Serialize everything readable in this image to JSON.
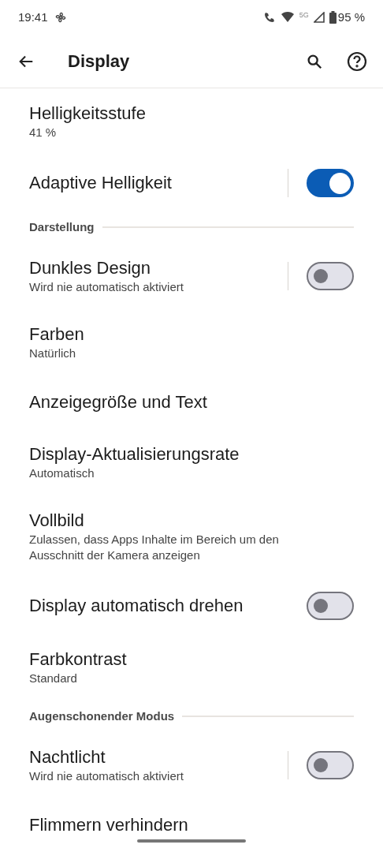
{
  "status_bar": {
    "time": "19:41",
    "battery": "95 %",
    "network": "5G"
  },
  "app_bar": {
    "title": "Display"
  },
  "items": [
    {
      "kind": "item",
      "title": "Helligkeitsstufe",
      "subtitle": "41 %"
    },
    {
      "kind": "toggle",
      "title": "Adaptive Helligkeit",
      "on": true,
      "divider": true
    },
    {
      "kind": "header",
      "title": "Darstellung"
    },
    {
      "kind": "toggle",
      "title": "Dunkles Design",
      "subtitle": "Wird nie automatisch aktiviert",
      "on": false,
      "divider": true
    },
    {
      "kind": "item",
      "title": "Farben",
      "subtitle": "Natürlich"
    },
    {
      "kind": "item",
      "title": "Anzeigegröße und Text"
    },
    {
      "kind": "item",
      "title": "Display-Aktualisierungsrate",
      "subtitle": "Automatisch"
    },
    {
      "kind": "item",
      "title": "Vollbild",
      "subtitle": "Zulassen, dass Apps Inhalte im Bereich um den Ausschnitt der Kamera anzeigen"
    },
    {
      "kind": "toggle",
      "title": "Display automatisch drehen",
      "on": false,
      "divider": false
    },
    {
      "kind": "item",
      "title": "Farbkontrast",
      "subtitle": "Standard"
    },
    {
      "kind": "header",
      "title": "Augenschonender Modus"
    },
    {
      "kind": "toggle",
      "title": "Nachtlicht",
      "subtitle": "Wird nie automatisch aktiviert",
      "on": false,
      "divider": true
    },
    {
      "kind": "item",
      "title": "Flimmern verhindern"
    }
  ]
}
